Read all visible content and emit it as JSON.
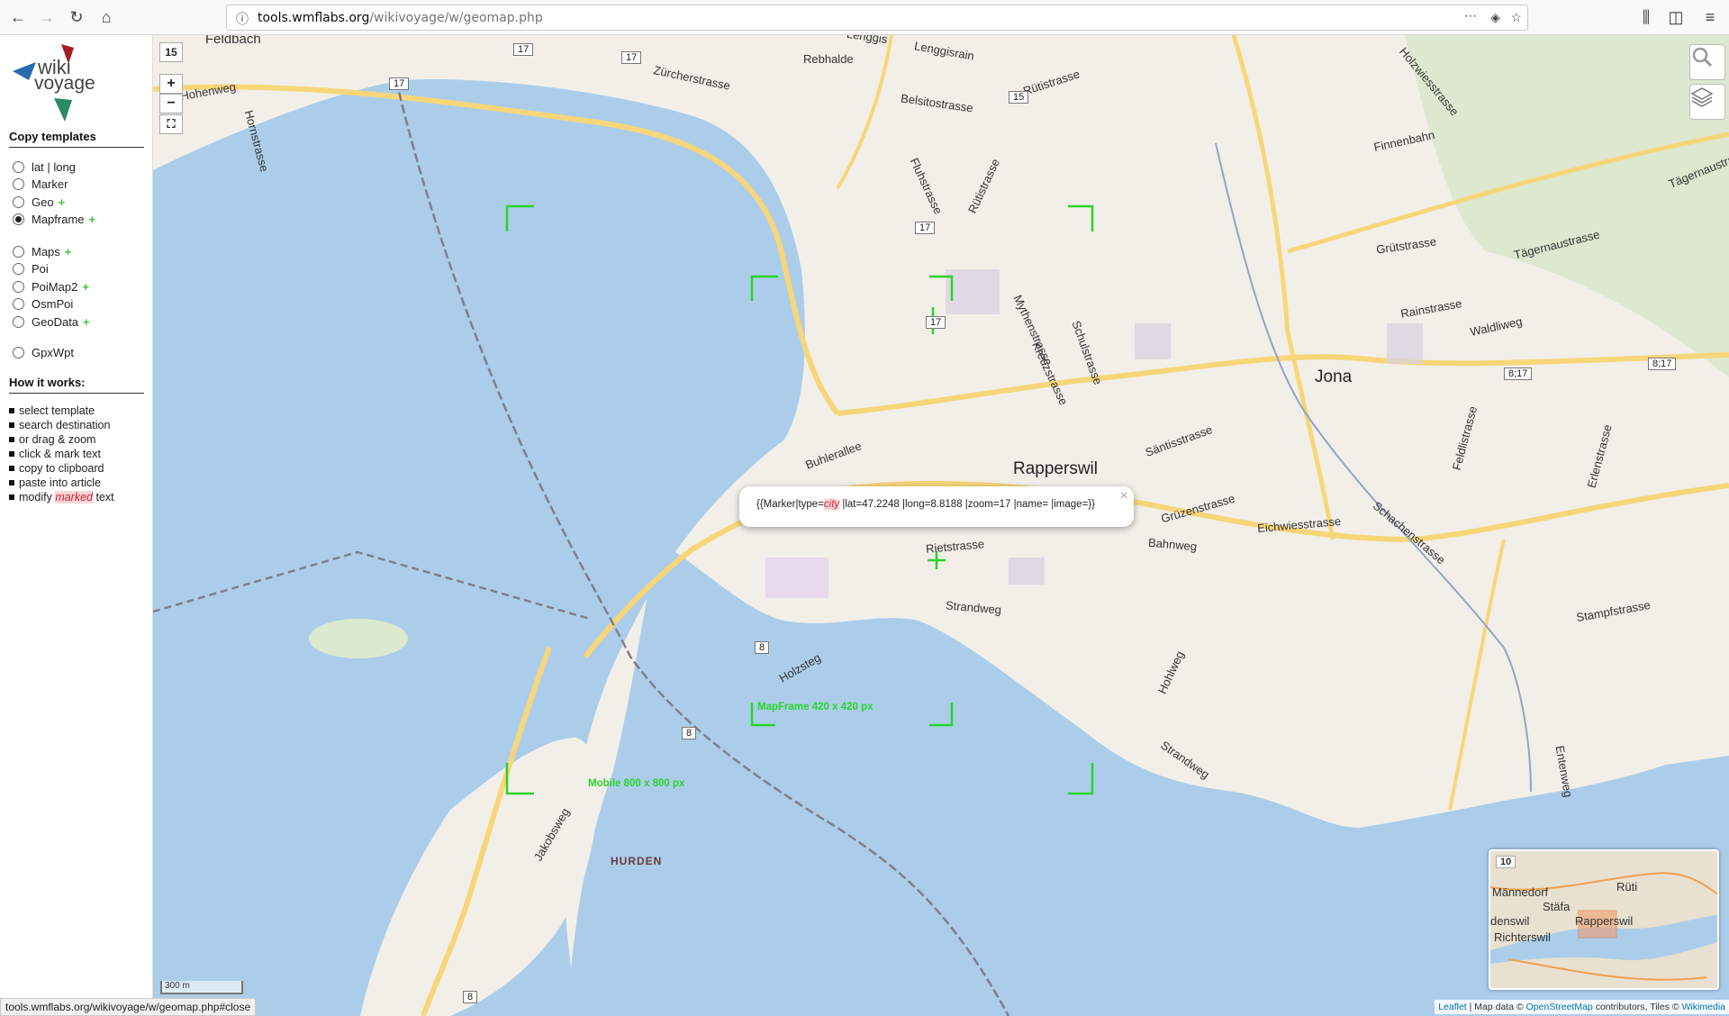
{
  "browser": {
    "url_domain": "tools.wmflabs.org",
    "url_path": "/wikivoyage/w/geomap.php",
    "status_url": "tools.wmflabs.org/wikivoyage/w/geomap.php#close"
  },
  "sidebar": {
    "logo_line1": "wiki",
    "logo_line2": "voyage",
    "copy_heading": "Copy templates",
    "templates": [
      {
        "label": "lat | long",
        "checked": false,
        "plus": false
      },
      {
        "label": "Marker",
        "checked": false,
        "plus": false
      },
      {
        "label": "Geo",
        "checked": false,
        "plus": true
      },
      {
        "label": "Mapframe",
        "checked": true,
        "plus": true
      },
      {
        "label": "Maps",
        "checked": false,
        "plus": true
      },
      {
        "label": "Poi",
        "checked": false,
        "plus": false
      },
      {
        "label": "PoiMap2",
        "checked": false,
        "plus": true
      },
      {
        "label": "OsmPoi",
        "checked": false,
        "plus": false
      },
      {
        "label": "GeoData",
        "checked": false,
        "plus": true
      },
      {
        "label": "GpxWpt",
        "checked": false,
        "plus": false
      }
    ],
    "plus_symbol": "+",
    "how_heading": "How it works:",
    "steps": [
      "select template",
      "search destination",
      "or drag & zoom",
      "click & mark text",
      "copy to clipboard",
      "paste into article"
    ],
    "last_step": {
      "before": "modify",
      "marked": "marked",
      "after": "text"
    }
  },
  "map": {
    "zoom_level": "15",
    "zoom_in": "+",
    "zoom_out": "−",
    "fullscreen": "⛶",
    "popup": {
      "before": "{{Marker|type=",
      "city": "city",
      "after": " |lat=47.2248 |long=8.8188 |zoom=17 |name= |image=}}",
      "close": "×"
    },
    "mapframe_label": "MapFrame 420 x 420 px",
    "mobile_label": "Mobile 800 x 800 px",
    "scale": "300 m",
    "places": {
      "rapperswil": "Rapperswil",
      "jona": "Jona",
      "hurden": "HURDEN",
      "feldbach": "Feldbach"
    },
    "streets": {
      "zurcherstrasse": "Zürcherstrasse",
      "rebhalde": "Rebhalde",
      "belsitostrasse": "Belsitostrasse",
      "rutistrasse": "Rütistrasse",
      "fluhstrasse": "Fluhstrasse",
      "rutistrasse2": "Rütistrasse",
      "mythenstrasse": "Mythenstrasse",
      "kreuzstrasse": "Kreuzstrasse",
      "schulstrasse": "Schulstrasse",
      "grutstrasse": "Grütstrasse",
      "tagernaustrasse": "Tägernaustrasse",
      "rainstrasse": "Rainstrasse",
      "waldliweg": "Waldliweg",
      "finnenbahn": "Finnenbahn",
      "buhlerallee": "Buhlerallee",
      "santisstrasse": "Säntisstrasse",
      "grunzenstrasse": "Grüzenstrasse",
      "eichwiesstrasse": "Eichwiesstrasse",
      "rietstrasse": "Rietstrasse",
      "bahnweg": "Bahnweg",
      "strandweg": "Strandweg",
      "holzsteg": "Holzsteg",
      "hohlweg": "Hohlweg",
      "strandweg2": "Strandweg",
      "jakobsweg": "Jakobsweg",
      "schachenstrasse": "Schachenstrasse",
      "feldlistrasse": "Feldlistrasse",
      "erlenstrasse": "Erlenstrasse",
      "stampfstrasse": "Stampfstrasse",
      "entenweg": "Entenweg",
      "hohenweg": "Hohenweg",
      "hornstrasse": "Hornstrasse",
      "holzwiesstrasse": "Holzwiesstrasse",
      "lenggis": "Lenggis",
      "lenggisrain": "Lenggisrain",
      "tagernaustrasse2": "Tägernaustrasse"
    },
    "shields": [
      "17",
      "17",
      "17",
      "15",
      "17",
      "17",
      "8;17",
      "8;17",
      "8",
      "8",
      "8"
    ],
    "minimap": {
      "zoom": "10",
      "labels": [
        "Männedorf",
        "Rüti",
        "Stäfa",
        "Rapperswil",
        "denswil",
        "Richterswil"
      ]
    },
    "attribution": {
      "leaflet": "Leaflet",
      "sep": " | Map data © ",
      "osm": "OpenStreetMap",
      "tiles": " contributors, Tiles © ",
      "wikimedia": "Wikimedia"
    }
  }
}
